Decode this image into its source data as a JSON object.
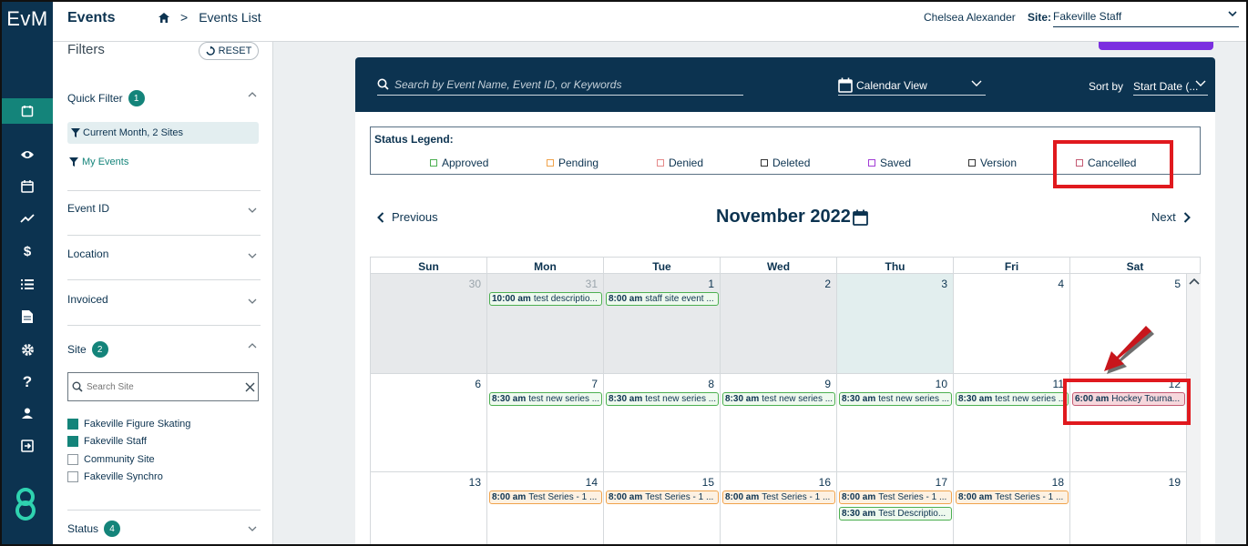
{
  "app": {
    "logo": "EvM",
    "title": "Events"
  },
  "breadcrumb": {
    "home_icon": "home-icon",
    "separator": ">",
    "current": "Events List"
  },
  "user": {
    "name": "Chelsea Alexander",
    "site_label": "Site:",
    "site_value": "Fakeville Staff"
  },
  "rail": {
    "icons": [
      "calendar-icon",
      "eye-icon",
      "calendar-icon",
      "chart-line-icon",
      "dollar-icon",
      "list-icon",
      "document-icon",
      "gear-icon",
      "help-icon",
      "user-icon",
      "logout-icon"
    ]
  },
  "filters": {
    "title": "Filters",
    "reset_label": "RESET",
    "quick_filter": {
      "label": "Quick Filter",
      "count": "1",
      "current": "Current Month, 2 Sites",
      "my_events": "My Events"
    },
    "event_id_label": "Event ID",
    "location_label": "Location",
    "invoiced_label": "Invoiced",
    "site": {
      "label": "Site",
      "count": "2",
      "search_placeholder": "Search Site",
      "items": [
        {
          "label": "Fakeville Figure Skating",
          "checked": true
        },
        {
          "label": "Fakeville Staff",
          "checked": true
        },
        {
          "label": "Community Site",
          "checked": false
        },
        {
          "label": "Fakeville Synchro",
          "checked": false
        }
      ]
    },
    "status": {
      "label": "Status",
      "count": "4"
    }
  },
  "toolbar": {
    "search_placeholder": "Search by Event Name, Event ID, or Keywords",
    "view_label": "Calendar View",
    "sort_label": "Sort by",
    "sort_value": "Start Date (..."
  },
  "legend": {
    "title": "Status Legend:",
    "items": [
      {
        "label": "Approved",
        "color": "#4caf50"
      },
      {
        "label": "Pending",
        "color": "#f0a34c"
      },
      {
        "label": "Denied",
        "color": "#e58a8a"
      },
      {
        "label": "Deleted",
        "color": "#333333"
      },
      {
        "label": "Saved",
        "color": "#a23cd6"
      },
      {
        "label": "Version",
        "color": "#333333"
      },
      {
        "label": "Cancelled",
        "color": "#c45a73"
      }
    ]
  },
  "calendar": {
    "prev_label": "Previous",
    "next_label": "Next",
    "month_label": "November 2022",
    "weekdays": [
      "Sun",
      "Mon",
      "Tue",
      "Wed",
      "Thu",
      "Fri",
      "Sat"
    ],
    "weeks": [
      {
        "days": [
          {
            "num": "30",
            "out": true,
            "events": []
          },
          {
            "num": "31",
            "out": true,
            "events": [
              {
                "time": "10:00 am",
                "title": "test descriptio...",
                "status": "approved"
              }
            ]
          },
          {
            "num": "1",
            "events": [
              {
                "time": "8:00 am",
                "title": "staff site event ...",
                "status": "approved"
              }
            ]
          },
          {
            "num": "2",
            "events": []
          },
          {
            "num": "3",
            "today": true,
            "events": []
          },
          {
            "num": "4",
            "events": []
          },
          {
            "num": "5",
            "events": []
          }
        ]
      },
      {
        "days": [
          {
            "num": "6",
            "events": []
          },
          {
            "num": "7",
            "events": [
              {
                "time": "8:30 am",
                "title": "test new series ...",
                "status": "approved"
              }
            ]
          },
          {
            "num": "8",
            "events": [
              {
                "time": "8:30 am",
                "title": "test new series ...",
                "status": "approved"
              }
            ]
          },
          {
            "num": "9",
            "events": [
              {
                "time": "8:30 am",
                "title": "test new series ...",
                "status": "approved"
              }
            ]
          },
          {
            "num": "10",
            "events": [
              {
                "time": "8:30 am",
                "title": "test new series ...",
                "status": "approved"
              }
            ]
          },
          {
            "num": "11",
            "events": [
              {
                "time": "8:30 am",
                "title": "test new series ...",
                "status": "approved"
              }
            ]
          },
          {
            "num": "12",
            "events": [
              {
                "time": "6:00 am",
                "title": "Hockey Tourna...",
                "status": "cancelled"
              }
            ]
          }
        ]
      },
      {
        "days": [
          {
            "num": "13",
            "events": []
          },
          {
            "num": "14",
            "events": [
              {
                "time": "8:00 am",
                "title": "Test Series - 1 ...",
                "status": "pending"
              }
            ]
          },
          {
            "num": "15",
            "events": [
              {
                "time": "8:00 am",
                "title": "Test Series - 1 ...",
                "status": "pending"
              }
            ]
          },
          {
            "num": "16",
            "events": [
              {
                "time": "8:00 am",
                "title": "Test Series - 1 ...",
                "status": "pending"
              }
            ]
          },
          {
            "num": "17",
            "events": [
              {
                "time": "8:00 am",
                "title": "Test Series - 1 ...",
                "status": "pending"
              },
              {
                "time": "8:30 am",
                "title": "Test Descriptio...",
                "status": "approved"
              }
            ]
          },
          {
            "num": "18",
            "events": [
              {
                "time": "8:00 am",
                "title": "Test Series - 1 ...",
                "status": "pending"
              }
            ]
          },
          {
            "num": "19",
            "events": []
          }
        ]
      }
    ]
  }
}
